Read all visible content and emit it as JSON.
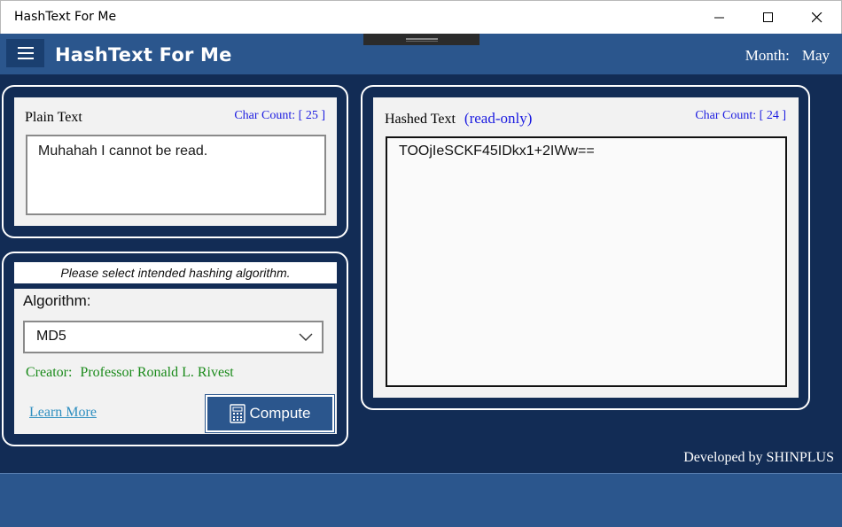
{
  "window": {
    "title": "HashText For Me",
    "controls": [
      "minimize-icon",
      "maximize-icon",
      "close-icon"
    ]
  },
  "header": {
    "app_title": "HashText For Me",
    "month_label": "Month:",
    "month_value": "May"
  },
  "plain_text": {
    "label": "Plain Text",
    "char_count": "Char Count: [ 25 ]",
    "value": "Muhahah I cannot be read."
  },
  "hashed_text": {
    "label": "Hashed Text",
    "readonly_note": "(read-only)",
    "char_count": "Char Count: [ 24 ]",
    "value": "TOOjIeSCKF45IDkx1+2IWw=="
  },
  "algorithm": {
    "hint": "Please select intended hashing algorithm.",
    "label": "Algorithm:",
    "selected": "MD5",
    "creator_label": "Creator:",
    "creator_name": "Professor Ronald L. Rivest",
    "learn_more": "Learn More",
    "compute_label": "Compute"
  },
  "footer": {
    "developer": "Developed by SHINPLUS"
  },
  "colors": {
    "header_bg": "#2b568d",
    "main_bg": "#122c55",
    "link": "#2f8fc0",
    "creator": "#1a8a1a",
    "count": "#1a1ae0"
  }
}
